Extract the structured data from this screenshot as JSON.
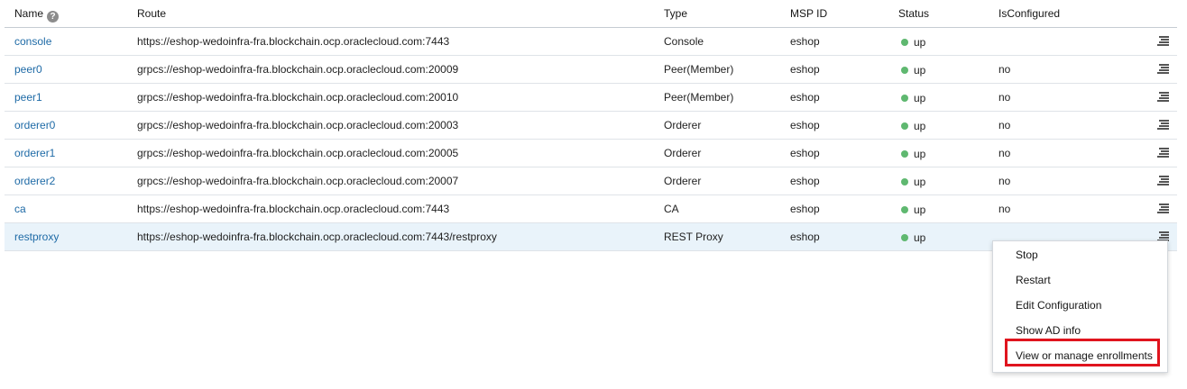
{
  "table": {
    "headers": {
      "name": "Name",
      "route": "Route",
      "type": "Type",
      "msp_id": "MSP ID",
      "status": "Status",
      "is_configured": "IsConfigured"
    },
    "rows": [
      {
        "name": "console",
        "route": "https://eshop-wedoinfra-fra.blockchain.ocp.oraclecloud.com:7443",
        "type": "Console",
        "msp_id": "eshop",
        "status": "up",
        "is_configured": ""
      },
      {
        "name": "peer0",
        "route": "grpcs://eshop-wedoinfra-fra.blockchain.ocp.oraclecloud.com:20009",
        "type": "Peer(Member)",
        "msp_id": "eshop",
        "status": "up",
        "is_configured": "no"
      },
      {
        "name": "peer1",
        "route": "grpcs://eshop-wedoinfra-fra.blockchain.ocp.oraclecloud.com:20010",
        "type": "Peer(Member)",
        "msp_id": "eshop",
        "status": "up",
        "is_configured": "no"
      },
      {
        "name": "orderer0",
        "route": "grpcs://eshop-wedoinfra-fra.blockchain.ocp.oraclecloud.com:20003",
        "type": "Orderer",
        "msp_id": "eshop",
        "status": "up",
        "is_configured": "no"
      },
      {
        "name": "orderer1",
        "route": "grpcs://eshop-wedoinfra-fra.blockchain.ocp.oraclecloud.com:20005",
        "type": "Orderer",
        "msp_id": "eshop",
        "status": "up",
        "is_configured": "no"
      },
      {
        "name": "orderer2",
        "route": "grpcs://eshop-wedoinfra-fra.blockchain.ocp.oraclecloud.com:20007",
        "type": "Orderer",
        "msp_id": "eshop",
        "status": "up",
        "is_configured": "no"
      },
      {
        "name": "ca",
        "route": "https://eshop-wedoinfra-fra.blockchain.ocp.oraclecloud.com:7443",
        "type": "CA",
        "msp_id": "eshop",
        "status": "up",
        "is_configured": "no"
      },
      {
        "name": "restproxy",
        "route": "https://eshop-wedoinfra-fra.blockchain.ocp.oraclecloud.com:7443/restproxy",
        "type": "REST Proxy",
        "msp_id": "eshop",
        "status": "up",
        "is_configured": ""
      }
    ],
    "selected_row": 7
  },
  "menu": {
    "items": [
      {
        "label": "Stop"
      },
      {
        "label": "Restart"
      },
      {
        "label": "Edit Configuration"
      },
      {
        "label": "Show AD info"
      },
      {
        "label": "View or manage enrollments",
        "highlighted": true
      }
    ]
  },
  "colors": {
    "link": "#1e6aa6",
    "status_up": "#5fb870",
    "selected_row_bg": "#e9f3fa",
    "highlight_border": "#e0141e"
  },
  "icons": {
    "help": "question-circle-icon",
    "row_actions": "hamburger-menu-icon"
  }
}
